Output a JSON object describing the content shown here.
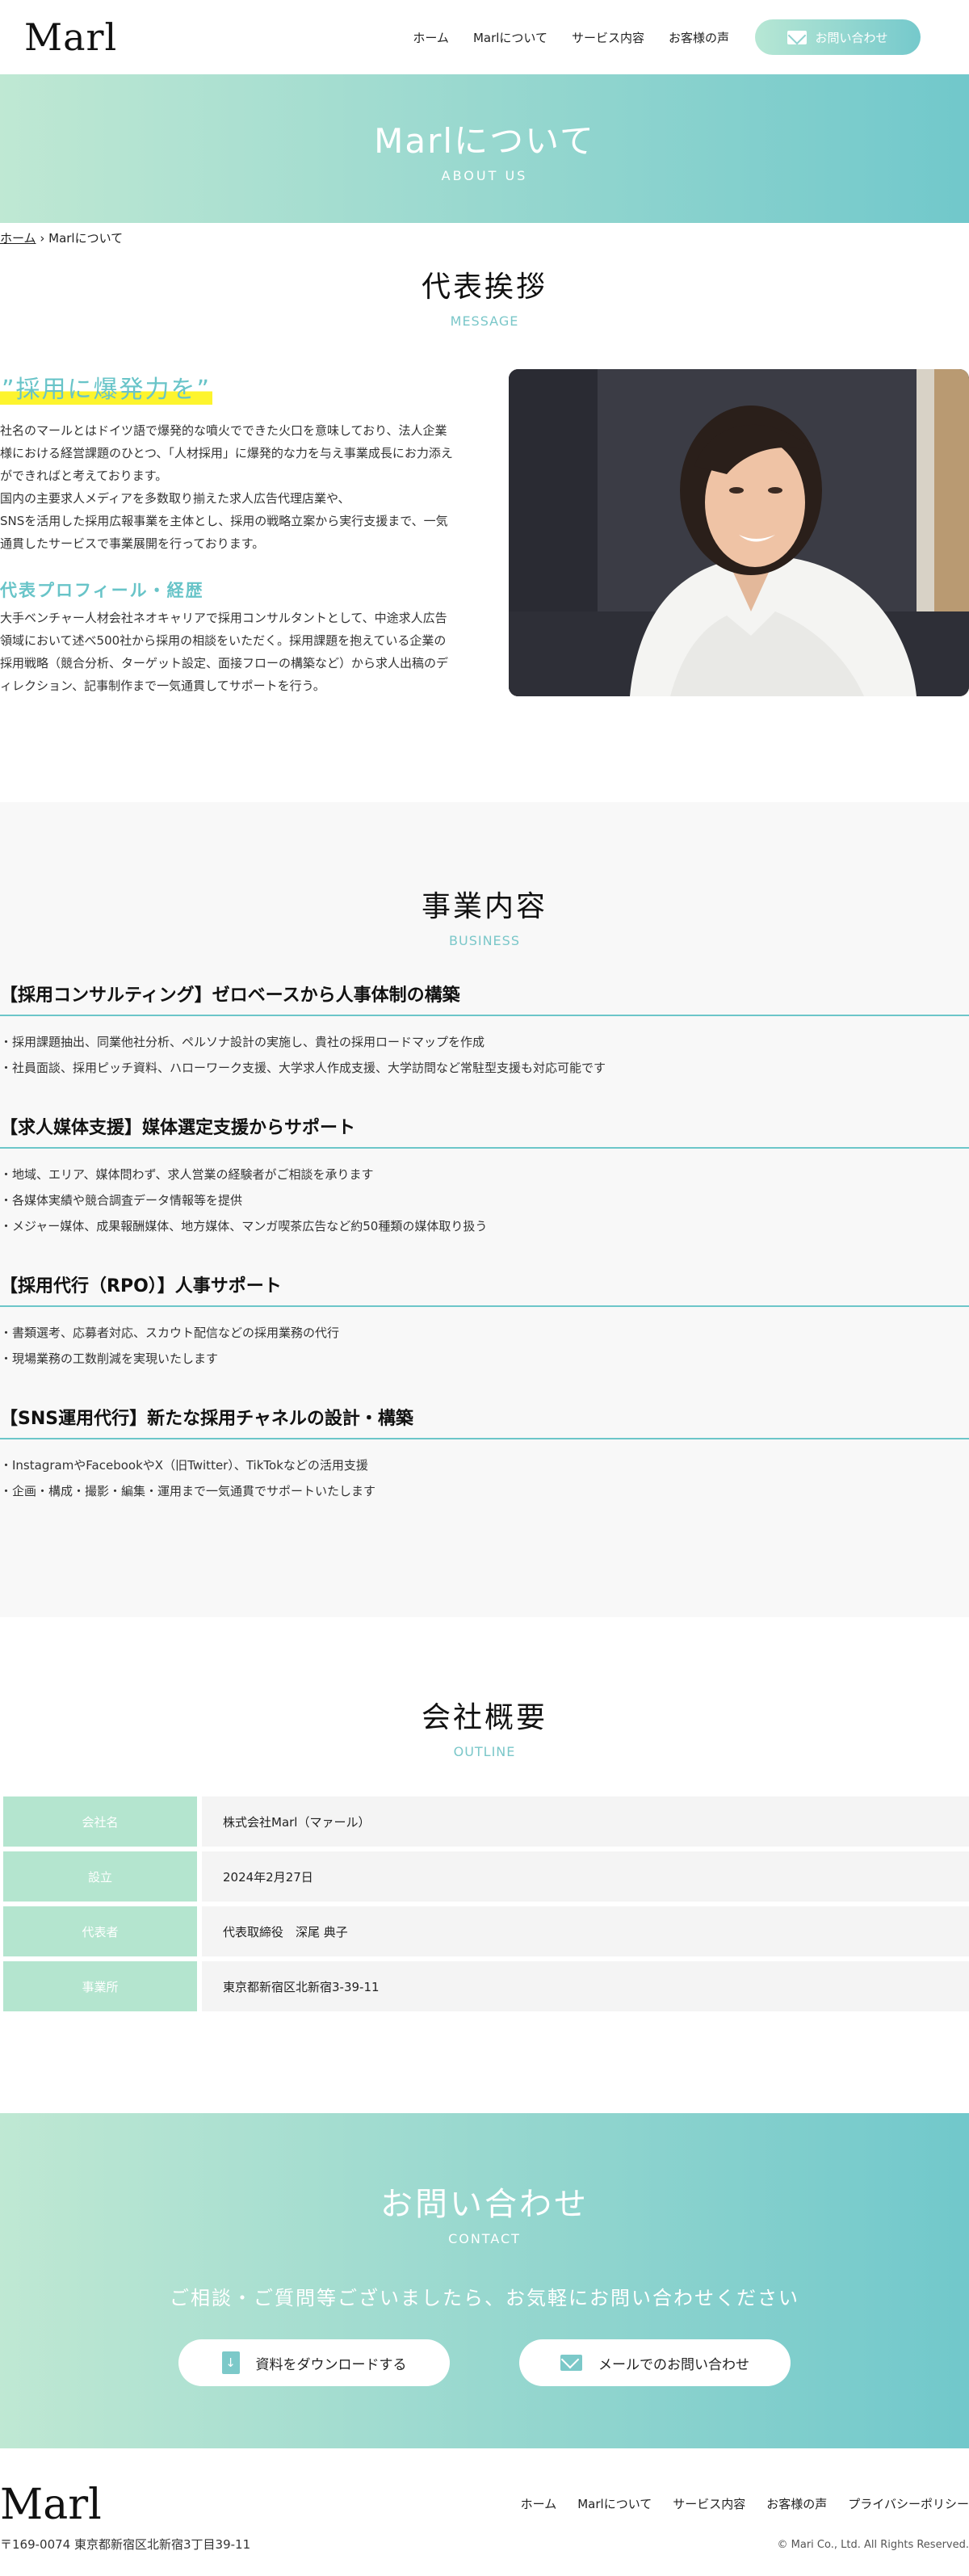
{
  "header": {
    "logo": "Marl",
    "nav": [
      "ホーム",
      "Marlについて",
      "サービス内容",
      "お客様の声"
    ],
    "contact_label": "お問い合わせ"
  },
  "hero": {
    "title": "Marlについて",
    "subtitle": "ABOUT US"
  },
  "breadcrumb": {
    "home": "ホーム",
    "separator": "›",
    "current": "Marlについて"
  },
  "message": {
    "title": "代表挨拶",
    "en": "MESSAGE",
    "catch": "”採用に爆発力を”",
    "para1": "社名のマールとはドイツ語で爆発的な噴火でできた火口を意味しており、法人企業様における経営課題のひとつ、「人材採用」に爆発的な力を与え事業成長にお力添えができればと考えております。\n国内の主要求人メディアを多数取り揃えた求人広告代理店業や、\nSNSを活用した採用広報事業を主体とし、採用の戦略立案から実行支援まで、一気通貫したサービスで事業展開を行っております。",
    "profile_title": "代表プロフィール・経歴",
    "profile_text": "大手ベンチャー人材会社ネオキャリアで採用コンサルタントとして、中途求人広告領域において述べ500社から採用の相談をいただく。採用課題を抱えている企業の採用戦略（競合分析、ターゲット設定、面接フローの構築など）から求人出稿のディレクション、記事制作まで一気通貫してサポートを行う。"
  },
  "business": {
    "title": "事業内容",
    "en": "BUSINESS",
    "items": [
      {
        "title": "【採用コンサルティング】ゼロベースから人事体制の構築",
        "points": [
          "・採用課題抽出、同業他社分析、ペルソナ設計の実施し、貴社の採用ロードマップを作成",
          "・社員面談、採用ピッチ資料、ハローワーク支援、大学求人作成支援、大学訪問など常駐型支援も対応可能です"
        ]
      },
      {
        "title": "【求人媒体支援】媒体選定支援からサポート",
        "points": [
          "・地域、エリア、媒体問わず、求人営業の経験者がご相談を承ります",
          "・各媒体実績や競合調査データ情報等を提供",
          "・メジャー媒体、成果報酬媒体、地方媒体、マンガ喫茶広告など約50種類の媒体取り扱う"
        ]
      },
      {
        "title": "【採用代行（RPO）】人事サポート",
        "points": [
          "・書類選考、応募者対応、スカウト配信などの採用業務の代行",
          "・現場業務の工数削減を実現いたします"
        ]
      },
      {
        "title": "【SNS運用代行】新たな採用チャネルの設計・構築",
        "points": [
          "・InstagramやFacebookやX（旧Twitter）、TikTokなどの活用支援",
          "・企画・構成・撮影・編集・運用まで一気通貫でサポートいたします"
        ]
      }
    ]
  },
  "outline": {
    "title": "会社概要",
    "en": "OUTLINE",
    "rows": [
      {
        "label": "会社名",
        "value": "株式会社Marl（マァール）"
      },
      {
        "label": "設立",
        "value": "2024年2月27日"
      },
      {
        "label": "代表者",
        "value": "代表取締役　深尾 典子"
      },
      {
        "label": "事業所",
        "value": "東京都新宿区北新宿3-39-11"
      }
    ]
  },
  "contact": {
    "title": "お問い合わせ",
    "en": "CONTACT",
    "lead": "ご相談・ご質問等ございましたら、お気軽にお問い合わせください",
    "download_label": "資料をダウンロードする",
    "mail_label": "メールでのお問い合わせ"
  },
  "footer": {
    "logo": "Marl",
    "address": "〒169-0074 東京都新宿区北新宿3丁目39-11",
    "nav": [
      "ホーム",
      "Marlについて",
      "サービス内容",
      "お客様の声",
      "プライバシーポリシー"
    ],
    "copyright": "© Mari Co., Ltd. All Rights Reserved."
  },
  "colors": {
    "accent": "#6cc6c9",
    "gradient_start": "#bfe8d3",
    "gradient_end": "#71c8cb",
    "highlight": "#fdf42d"
  }
}
